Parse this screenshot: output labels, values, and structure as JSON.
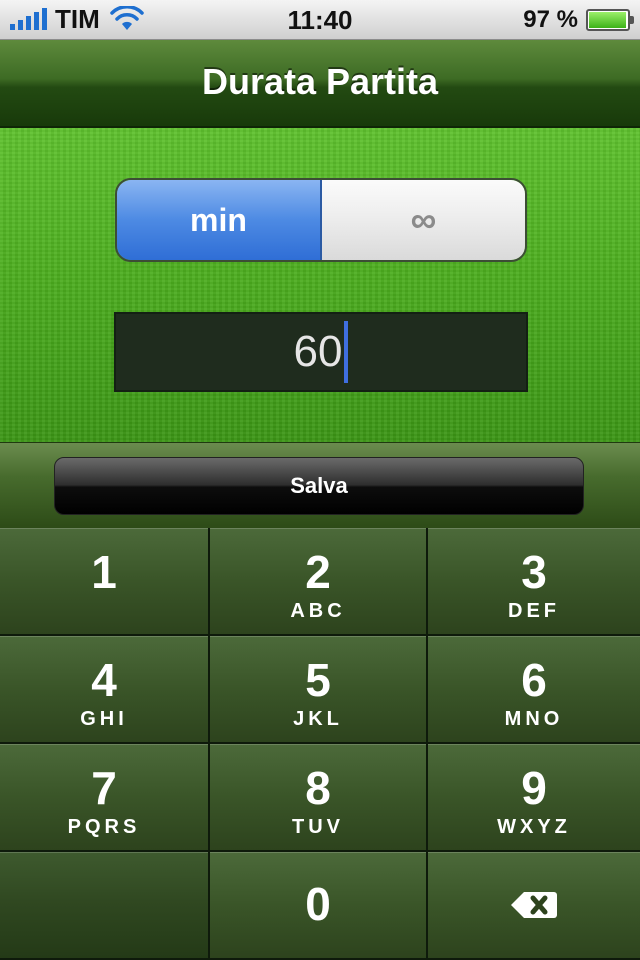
{
  "status_bar": {
    "carrier": "TIM",
    "time": "11:40",
    "battery_percent": "97 %",
    "battery_level": 0.97,
    "signal_bars": 5,
    "wifi_icon": "wifi-icon"
  },
  "navbar": {
    "title": "Durata Partita"
  },
  "segmented": {
    "options": [
      "min",
      "∞"
    ],
    "selected_index": 0
  },
  "duration_input": {
    "value": "60"
  },
  "save_button": {
    "label": "Salva"
  },
  "keypad": {
    "keys": [
      {
        "num": "1",
        "letters": ""
      },
      {
        "num": "2",
        "letters": "ABC"
      },
      {
        "num": "3",
        "letters": "DEF"
      },
      {
        "num": "4",
        "letters": "GHI"
      },
      {
        "num": "5",
        "letters": "JKL"
      },
      {
        "num": "6",
        "letters": "MNO"
      },
      {
        "num": "7",
        "letters": "PQRS"
      },
      {
        "num": "8",
        "letters": "TUV"
      },
      {
        "num": "9",
        "letters": "WXYZ"
      },
      {
        "num": "0",
        "letters": ""
      }
    ],
    "delete_icon": "backspace-icon"
  },
  "colors": {
    "accent_blue": "#2f6ed6",
    "field_green": "#4daf1f",
    "keypad_green": "#3a5528",
    "caret": "#3f6fe0"
  }
}
